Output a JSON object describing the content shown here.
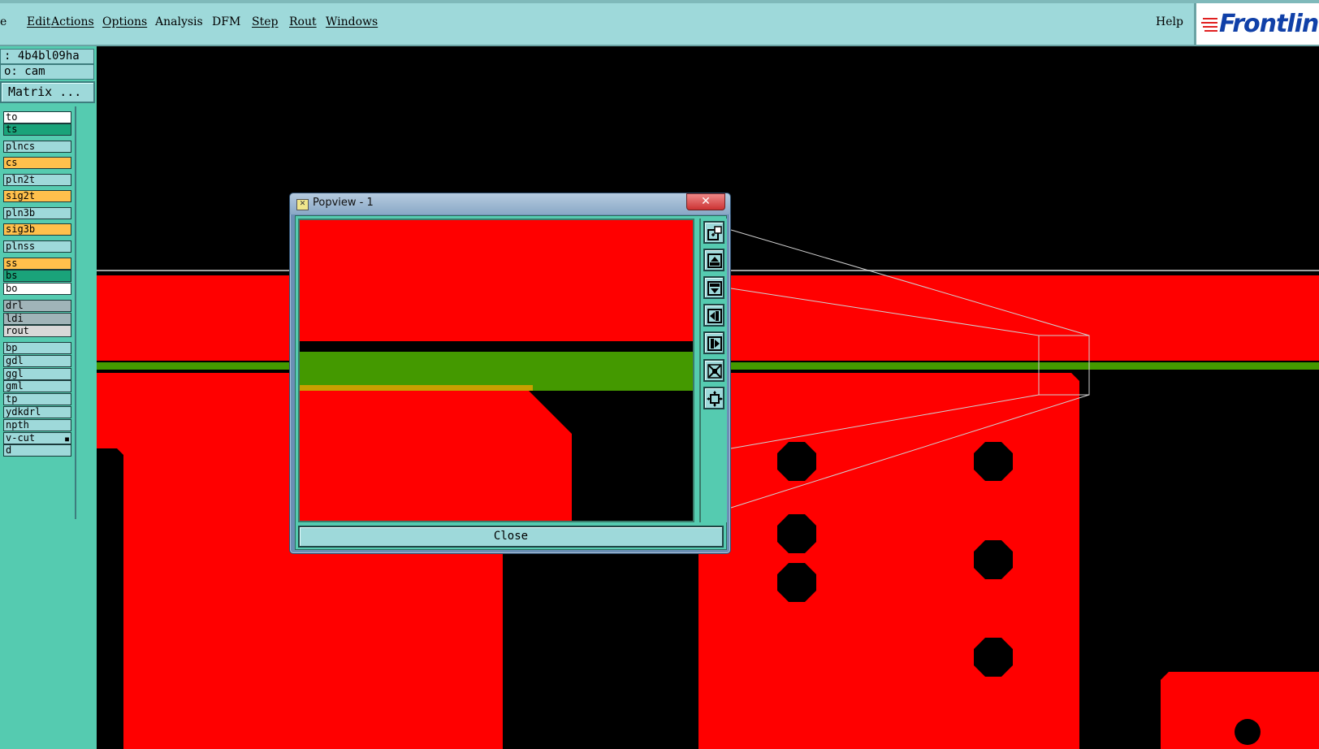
{
  "menubar": {
    "items": [
      "e",
      "Edit",
      "Actions",
      "Options",
      "Analysis",
      "DFM",
      "Step",
      "Rout",
      "Windows"
    ],
    "help": "Help",
    "logo": "Frontline"
  },
  "left_panel": {
    "job": ": 4b4bl09ha",
    "step": "o: cam",
    "matrix_button": "Matrix ...",
    "layers": [
      {
        "name": "to",
        "color": "#ffffff"
      },
      {
        "name": "ts",
        "color": "#1aa37a"
      },
      {
        "name": "plncs",
        "color": "#9ed9da"
      },
      {
        "name": "cs",
        "color": "#ffc04c"
      },
      {
        "name": "pln2t",
        "color": "#9ed9da"
      },
      {
        "name": "sig2t",
        "color": "#ffc04c"
      },
      {
        "name": "pln3b",
        "color": "#9ed9da"
      },
      {
        "name": "sig3b",
        "color": "#ffc04c"
      },
      {
        "name": "plnss",
        "color": "#9ed9da"
      },
      {
        "name": "ss",
        "color": "#ffc04c"
      },
      {
        "name": "bs",
        "color": "#1aa37a"
      },
      {
        "name": "bo",
        "color": "#ffffff"
      },
      {
        "name": "drl",
        "color": "#a0b4b8"
      },
      {
        "name": "ldi",
        "color": "#a0b4b8"
      },
      {
        "name": "rout",
        "color": "#d8d8d8"
      },
      {
        "name": "bp",
        "color": "#9ed9da"
      },
      {
        "name": "gdl",
        "color": "#9ed9da"
      },
      {
        "name": "ggl",
        "color": "#9ed9da"
      },
      {
        "name": "gml",
        "color": "#9ed9da"
      },
      {
        "name": "tp",
        "color": "#9ed9da"
      },
      {
        "name": "ydkdrl",
        "color": "#9ed9da"
      },
      {
        "name": "npth",
        "color": "#9ed9da"
      },
      {
        "name": "v-cut",
        "color": "#9ed9da",
        "mark": "■"
      },
      {
        "name": "d",
        "color": "#9ed9da"
      }
    ]
  },
  "popview": {
    "title": "Popview - 1",
    "close_x": "✕",
    "close_button": "Close",
    "tools": [
      "zoom-home-icon",
      "pan-up-icon",
      "pan-down-icon",
      "pan-left-icon",
      "pan-right-icon",
      "zoom-in-icon",
      "zoom-out-icon"
    ]
  },
  "colors": {
    "copper": "#ff0000",
    "trace": "#449900",
    "panel": "#55cbb0",
    "menu": "#9ed9da"
  }
}
